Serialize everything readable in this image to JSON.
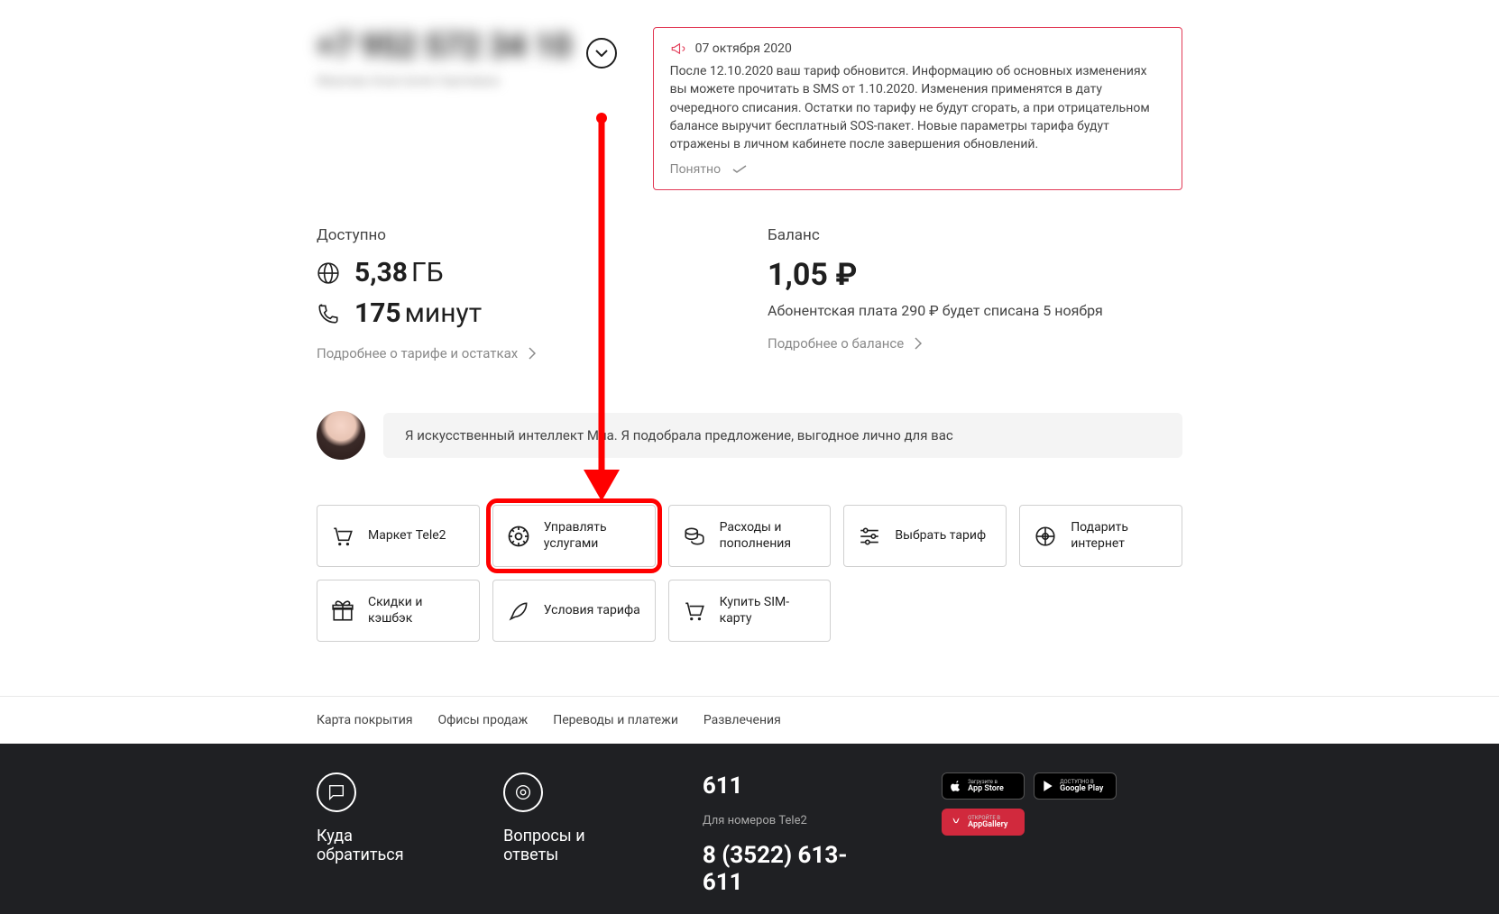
{
  "phone": {
    "number": "+7 952 572 34 10",
    "name": "Иванова Анастасия Сергеевна"
  },
  "notice": {
    "date": "07 октября 2020",
    "body": "После 12.10.2020 ваш тариф обновится. Информацию об основных изменениях вы можете прочитать в SMS от 1.10.2020. Изменения применятся в дату очередного списания. Остатки по тарифу не будут сгорать, а при отрицательном балансе выручит бесплатный SOS-пакет. Новые параметры тарифа будут отражены в личном кабинете после завершения обновлений.",
    "ok": "Понятно"
  },
  "available": {
    "label": "Доступно",
    "data": "5,38",
    "data_unit": "ГБ",
    "minutes": "175",
    "minutes_unit": "минут",
    "more": "Подробнее о тарифе и остатках"
  },
  "balance": {
    "label": "Баланс",
    "value": "1,05 ₽",
    "note": "Абонентская плата 290 ₽ будет списана 5 ноября",
    "more": "Подробнее о балансе"
  },
  "mia": {
    "text": "Я искусственный интеллект Миа. Я подобрала предложение, выгодное лично для вас"
  },
  "tiles": [
    {
      "label": "Маркет Tele2"
    },
    {
      "label": "Управлять услугами"
    },
    {
      "label": "Расходы и пополнения"
    },
    {
      "label": "Выбрать тариф"
    },
    {
      "label": "Подарить интернет"
    },
    {
      "label": "Скидки и кэшбэк"
    },
    {
      "label": "Условия тарифа"
    },
    {
      "label": "Купить SIM-карту"
    }
  ],
  "footer_links": [
    "Карта покрытия",
    "Офисы продаж",
    "Переводы и платежи",
    "Развлечения"
  ],
  "dark_footer": {
    "contact": "Куда обратиться",
    "faq": "Вопросы и ответы",
    "short": "611",
    "short_sub": "Для номеров Tele2",
    "long": "8 (3522) 613-611",
    "stores": {
      "appstore_small": "Загрузите в",
      "appstore_big": "App Store",
      "google_small": "ДОСТУПНО В",
      "google_big": "Google Play",
      "huawei_small": "ОТКРОЙТЕ В",
      "huawei_big": "AppGallery"
    }
  }
}
